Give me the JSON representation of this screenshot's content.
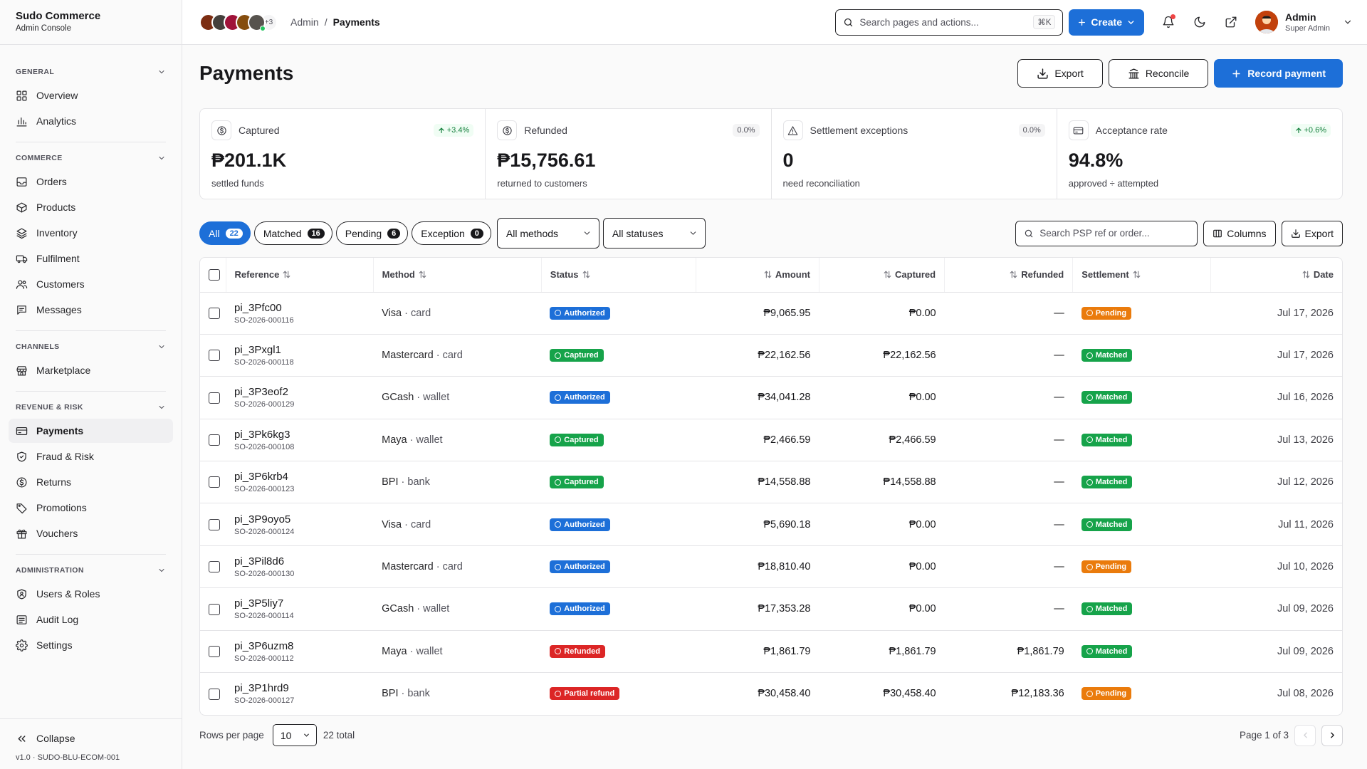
{
  "brand": {
    "name": "Sudo Commerce",
    "subtitle": "Admin Console"
  },
  "sidebar": {
    "sections": [
      {
        "title": "GENERAL",
        "items": [
          {
            "label": "Overview",
            "icon": "grid-icon"
          },
          {
            "label": "Analytics",
            "icon": "bar-chart-icon"
          }
        ]
      },
      {
        "title": "COMMERCE",
        "items": [
          {
            "label": "Orders",
            "icon": "inbox-icon"
          },
          {
            "label": "Products",
            "icon": "box-icon"
          },
          {
            "label": "Inventory",
            "icon": "layers-icon"
          },
          {
            "label": "Fulfilment",
            "icon": "truck-icon"
          },
          {
            "label": "Customers",
            "icon": "users-icon"
          },
          {
            "label": "Messages",
            "icon": "chat-icon"
          }
        ]
      },
      {
        "title": "CHANNELS",
        "items": [
          {
            "label": "Marketplace",
            "icon": "store-icon"
          }
        ]
      },
      {
        "title": "REVENUE & RISK",
        "items": [
          {
            "label": "Payments",
            "icon": "credit-card-icon",
            "active": true
          },
          {
            "label": "Fraud & Risk",
            "icon": "shield-icon"
          },
          {
            "label": "Returns",
            "icon": "dollar-circle-icon"
          },
          {
            "label": "Promotions",
            "icon": "tag-icon"
          },
          {
            "label": "Vouchers",
            "icon": "gift-icon"
          }
        ]
      },
      {
        "title": "ADMINISTRATION",
        "items": [
          {
            "label": "Users & Roles",
            "icon": "user-shield-icon"
          },
          {
            "label": "Audit Log",
            "icon": "list-icon"
          },
          {
            "label": "Settings",
            "icon": "gear-icon"
          }
        ]
      }
    ],
    "collapse_label": "Collapse",
    "version": "v1.0 · SUDO-BLU-ECOM-001"
  },
  "topbar": {
    "avatars_more": "+3",
    "breadcrumb": [
      "Admin",
      "/",
      "Payments"
    ],
    "search_placeholder": "Search pages and actions...",
    "search_shortcut": "⌘K",
    "create_label": "Create",
    "user": {
      "name": "Admin",
      "role": "Super Admin"
    }
  },
  "page": {
    "title": "Payments",
    "actions": {
      "export": "Export",
      "reconcile": "Reconcile",
      "record": "Record payment"
    }
  },
  "kpis": [
    {
      "label": "Captured",
      "value": "₱201.1K",
      "sub": "settled funds",
      "delta": "+3.4%",
      "trend": "up",
      "icon": "dollar-circle-icon"
    },
    {
      "label": "Refunded",
      "value": "₱15,756.61",
      "sub": "returned to customers",
      "delta": "0.0%",
      "trend": "flat",
      "icon": "dollar-circle-icon"
    },
    {
      "label": "Settlement exceptions",
      "value": "0",
      "sub": "need reconciliation",
      "delta": "0.0%",
      "trend": "flat",
      "icon": "warning-icon"
    },
    {
      "label": "Acceptance rate",
      "value": "94.8%",
      "sub": "approved ÷ attempted",
      "delta": "+0.6%",
      "trend": "up",
      "icon": "credit-card-icon"
    }
  ],
  "filters": {
    "tabs": [
      {
        "label": "All",
        "count": "22",
        "active": true
      },
      {
        "label": "Matched",
        "count": "16"
      },
      {
        "label": "Pending",
        "count": "6"
      },
      {
        "label": "Exception",
        "count": "0"
      }
    ],
    "method_select": "All methods",
    "status_select": "All statuses",
    "search_placeholder": "Search PSP ref or order...",
    "columns_label": "Columns",
    "export_label": "Export"
  },
  "table": {
    "headers": {
      "reference": "Reference",
      "method": "Method",
      "status": "Status",
      "amount": "Amount",
      "captured": "Captured",
      "refunded": "Refunded",
      "settlement": "Settlement",
      "date": "Date"
    },
    "rows": [
      {
        "ref": "pi_3Pfc00",
        "order": "SO-2026-000116",
        "method": "Visa",
        "method_type": "card",
        "status": "Authorized",
        "amount": "₱9,065.95",
        "captured": "₱0.00",
        "refunded": "—",
        "settlement": "Pending",
        "date": "Jul 17, 2026"
      },
      {
        "ref": "pi_3Pxgl1",
        "order": "SO-2026-000118",
        "method": "Mastercard",
        "method_type": "card",
        "status": "Captured",
        "amount": "₱22,162.56",
        "captured": "₱22,162.56",
        "refunded": "—",
        "settlement": "Matched",
        "date": "Jul 17, 2026"
      },
      {
        "ref": "pi_3P3eof2",
        "order": "SO-2026-000129",
        "method": "GCash",
        "method_type": "wallet",
        "status": "Authorized",
        "amount": "₱34,041.28",
        "captured": "₱0.00",
        "refunded": "—",
        "settlement": "Matched",
        "date": "Jul 16, 2026"
      },
      {
        "ref": "pi_3Pk6kg3",
        "order": "SO-2026-000108",
        "method": "Maya",
        "method_type": "wallet",
        "status": "Captured",
        "amount": "₱2,466.59",
        "captured": "₱2,466.59",
        "refunded": "—",
        "settlement": "Matched",
        "date": "Jul 13, 2026"
      },
      {
        "ref": "pi_3P6krb4",
        "order": "SO-2026-000123",
        "method": "BPI",
        "method_type": "bank",
        "status": "Captured",
        "amount": "₱14,558.88",
        "captured": "₱14,558.88",
        "refunded": "—",
        "settlement": "Matched",
        "date": "Jul 12, 2026"
      },
      {
        "ref": "pi_3P9oyo5",
        "order": "SO-2026-000124",
        "method": "Visa",
        "method_type": "card",
        "status": "Authorized",
        "amount": "₱5,690.18",
        "captured": "₱0.00",
        "refunded": "—",
        "settlement": "Matched",
        "date": "Jul 11, 2026"
      },
      {
        "ref": "pi_3Pil8d6",
        "order": "SO-2026-000130",
        "method": "Mastercard",
        "method_type": "card",
        "status": "Authorized",
        "amount": "₱18,810.40",
        "captured": "₱0.00",
        "refunded": "—",
        "settlement": "Pending",
        "date": "Jul 10, 2026"
      },
      {
        "ref": "pi_3P5liy7",
        "order": "SO-2026-000114",
        "method": "GCash",
        "method_type": "wallet",
        "status": "Authorized",
        "amount": "₱17,353.28",
        "captured": "₱0.00",
        "refunded": "—",
        "settlement": "Matched",
        "date": "Jul 09, 2026"
      },
      {
        "ref": "pi_3P6uzm8",
        "order": "SO-2026-000112",
        "method": "Maya",
        "method_type": "wallet",
        "status": "Refunded",
        "amount": "₱1,861.79",
        "captured": "₱1,861.79",
        "refunded": "₱1,861.79",
        "settlement": "Matched",
        "date": "Jul 09, 2026"
      },
      {
        "ref": "pi_3P1hrd9",
        "order": "SO-2026-000127",
        "method": "BPI",
        "method_type": "bank",
        "status": "Partial refund",
        "amount": "₱30,458.40",
        "captured": "₱30,458.40",
        "refunded": "₱12,183.36",
        "settlement": "Pending",
        "date": "Jul 08, 2026"
      }
    ]
  },
  "pagination": {
    "rows_per_page_label": "Rows per page",
    "rows_per_page": "10",
    "total": "22 total",
    "page_label": "Page 1 of 3"
  },
  "colors": {
    "primary": "#1d6fd8",
    "success": "#16a34a",
    "warning": "#ea7b0c",
    "danger": "#dc2626"
  }
}
